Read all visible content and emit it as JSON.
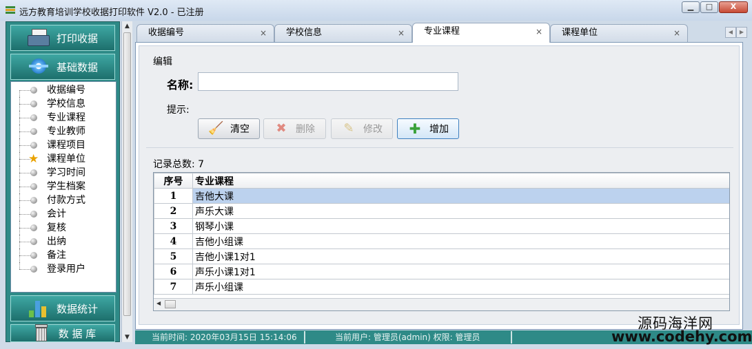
{
  "window": {
    "title": "远方教育培训学校收据打印软件 V2.0 - 已注册",
    "min_label": "▁",
    "max_label": "□",
    "close_label": "X"
  },
  "sidebar": {
    "print_label": "打印收据",
    "basic_label": "基础数据",
    "stats_label": "数据统计",
    "db_label": "数 据 库",
    "tree": [
      {
        "label": "收据编号",
        "icon": "dot"
      },
      {
        "label": "学校信息",
        "icon": "dot"
      },
      {
        "label": "专业课程",
        "icon": "dot"
      },
      {
        "label": "专业教师",
        "icon": "dot"
      },
      {
        "label": "课程项目",
        "icon": "dot"
      },
      {
        "label": "课程单位",
        "icon": "star"
      },
      {
        "label": "学习时间",
        "icon": "dot"
      },
      {
        "label": "学生档案",
        "icon": "dot"
      },
      {
        "label": "付款方式",
        "icon": "dot"
      },
      {
        "label": "会计",
        "icon": "dot"
      },
      {
        "label": "复核",
        "icon": "dot"
      },
      {
        "label": "出纳",
        "icon": "dot"
      },
      {
        "label": "备注",
        "icon": "dot"
      },
      {
        "label": "登录用户",
        "icon": "dot"
      }
    ]
  },
  "tabs": [
    {
      "label": "收据编号",
      "close": "×",
      "active": false
    },
    {
      "label": "学校信息",
      "close": "×",
      "active": false
    },
    {
      "label": "专业课程",
      "close": "×",
      "active": true
    },
    {
      "label": "课程单位",
      "close": "×",
      "active": false
    }
  ],
  "form": {
    "group_label": "编辑",
    "name_label": "名称:",
    "name_value": "",
    "hint_label": "提示:",
    "buttons": {
      "clear": "清空",
      "delete": "删除",
      "modify": "修改",
      "add": "增加"
    },
    "record_count_label": "记录总数: 7"
  },
  "table": {
    "headers": [
      "序号",
      "专业课程"
    ],
    "rows": [
      {
        "no": "1",
        "name": "吉他大课",
        "selected": true
      },
      {
        "no": "2",
        "name": "声乐大课",
        "selected": false
      },
      {
        "no": "3",
        "name": "钢琴小课",
        "selected": false
      },
      {
        "no": "4",
        "name": "吉他小组课",
        "selected": false
      },
      {
        "no": "5",
        "name": "吉他小课1对1",
        "selected": false
      },
      {
        "no": "6",
        "name": "声乐小课1对1",
        "selected": false
      },
      {
        "no": "7",
        "name": "声乐小组课",
        "selected": false
      }
    ]
  },
  "status": {
    "time": "当前时间: 2020年03月15日 15:14:06",
    "user": "当前用户: 管理员(admin)  权限: 管理员"
  },
  "watermark": {
    "line1": "源码海洋网",
    "line2": "www.codehy.com"
  },
  "colors": {
    "sidebar": "#2e8a87",
    "selected_row": "#bcd2ee",
    "star": "#e9a200"
  }
}
